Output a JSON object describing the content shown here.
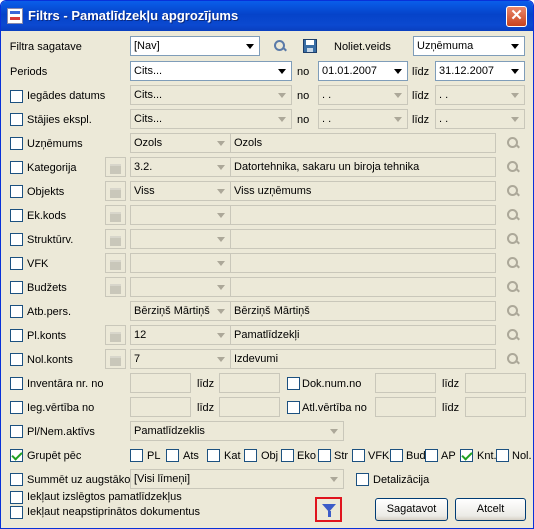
{
  "window": {
    "title": "Filtrs - Pamatlīdzekļu apgrozījums",
    "close": "✕"
  },
  "row_filtra": {
    "label": "Filtra sagatave",
    "value": "[Nav]",
    "noliet_label": "Noliet.veids",
    "noliet_value": "Uzņēmuma"
  },
  "row_periods": {
    "label": "Periods",
    "value": "Cits...",
    "no": "no",
    "from": "01.01.2007",
    "lidz": "līdz",
    "to": "31.12.2007"
  },
  "row_iegades": {
    "label": "Iegādes datums",
    "value": "Cits...",
    "no": "no",
    "from": " .  . ",
    "lidz": "līdz",
    "to": " .  . "
  },
  "row_stajies": {
    "label": "Stājies ekspl.",
    "value": "Cits...",
    "no": "no",
    "from": " .  . ",
    "lidz": "līdz",
    "to": " .  . "
  },
  "row_uznemums": {
    "label": "Uzņēmums",
    "code": "Ozols",
    "name": "Ozols"
  },
  "row_kategorija": {
    "label": "Kategorija",
    "code": "3.2.",
    "name": "Datortehnika, sakaru un biroja tehnika"
  },
  "row_objekts": {
    "label": "Objekts",
    "code": "Viss",
    "name": "Viss uzņēmums"
  },
  "row_ekkods": {
    "label": "Ek.kods",
    "code": "",
    "name": ""
  },
  "row_struktvr": {
    "label": "Struktūrv.",
    "code": "",
    "name": ""
  },
  "row_vfk": {
    "label": "VFK",
    "code": "",
    "name": ""
  },
  "row_budzets": {
    "label": "Budžets",
    "code": "",
    "name": ""
  },
  "row_atbpers": {
    "label": "Atb.pers.",
    "code": "Bērziņš Mārtiņš",
    "name": "Bērziņš Mārtiņš"
  },
  "row_plkonts": {
    "label": "Pl.konts",
    "code": "12",
    "name": "Pamatlīdzekļi"
  },
  "row_nolkonts": {
    "label": "Nol.konts",
    "code": "7",
    "name": "Izdevumi"
  },
  "row_inventara": {
    "label": "Inventāra nr. no",
    "lidz": "līdz",
    "dok_label": "Dok.num.no",
    "lidz2": "līdz"
  },
  "row_iegvert": {
    "label": "Ieg.vērtība no",
    "lidz": "līdz",
    "atl_label": "Atl.vērtība no",
    "lidz2": "līdz"
  },
  "row_plnem": {
    "label": "Pl/Nem.aktīvs",
    "value": "Pamatlīdzeklis"
  },
  "row_grupet": {
    "label": "Grupēt pēc",
    "items": [
      "PL",
      "Ats",
      "Kat",
      "Obj",
      "Eko",
      "Str",
      "VFK",
      "Bud",
      "AP",
      "Knt.",
      "Nol."
    ]
  },
  "row_summet": {
    "label": "Summēt uz augstāko",
    "value": "[Visi līmeņi]",
    "detal": "Detalizācija"
  },
  "row_iekl1": {
    "label": "Iekļaut izslēgtos pamatlīdzekļus"
  },
  "row_iekl2": {
    "label": "Iekļaut neapstiprinātos dokumentus"
  },
  "buttons": {
    "sagatavot": "Sagatavot",
    "atcelt": "Atcelt"
  }
}
